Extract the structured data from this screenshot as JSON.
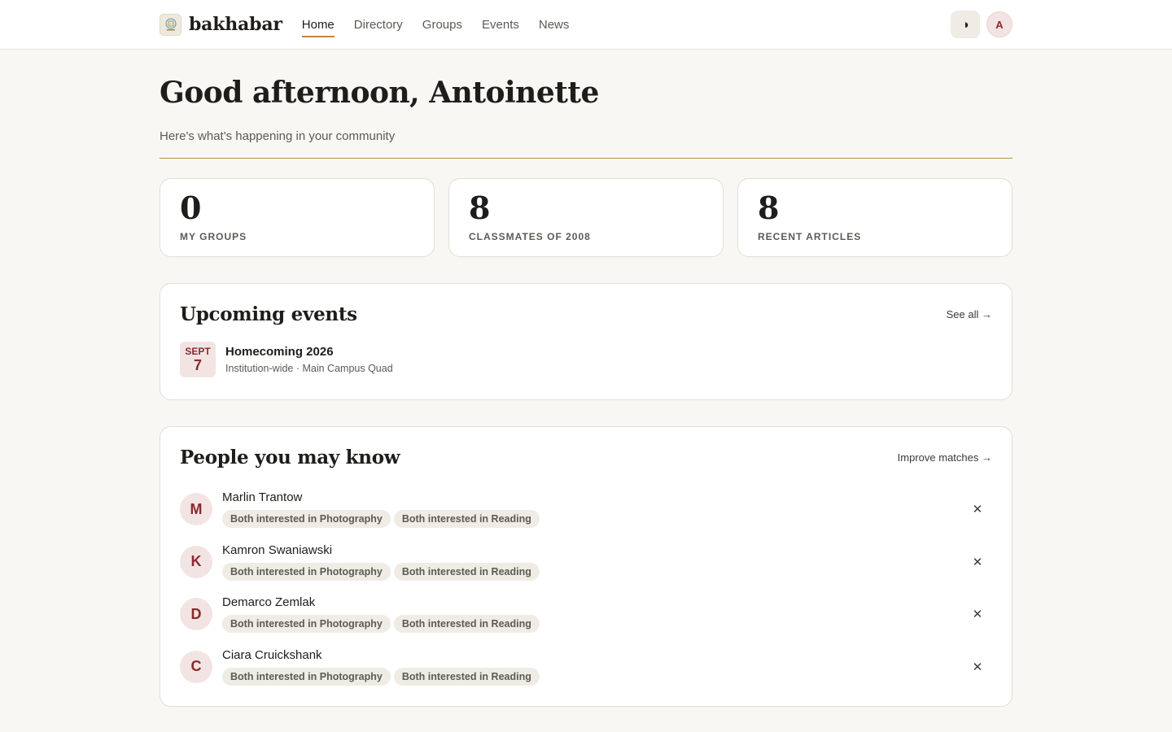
{
  "header": {
    "brand": "bakhabar",
    "nav": [
      {
        "label": "Home",
        "active": true
      },
      {
        "label": "Directory",
        "active": false
      },
      {
        "label": "Groups",
        "active": false
      },
      {
        "label": "Events",
        "active": false
      },
      {
        "label": "News",
        "active": false
      }
    ],
    "theme_toggle_icon": "◑",
    "user_initial": "A"
  },
  "main": {
    "greeting": "Good afternoon, Antoinette",
    "subtitle": "Here's what's happening in your community",
    "stats": [
      {
        "value": "0",
        "label": "My groups"
      },
      {
        "value": "8",
        "label": "Classmates of 2008"
      },
      {
        "value": "8",
        "label": "Recent articles"
      }
    ]
  },
  "events": {
    "title": "Upcoming events",
    "see_all": "See all →",
    "items": [
      {
        "month": "SEPT",
        "day": "7",
        "title": "Homecoming 2026",
        "meta": "Institution-wide · Main Campus Quad"
      }
    ]
  },
  "people": {
    "title": "People you may know",
    "improve": "Improve matches →",
    "dismiss_icon": "✕",
    "items": [
      {
        "initial": "M",
        "name": "Marlin Trantow",
        "tags": [
          "Both interested in Photography",
          "Both interested in Reading"
        ]
      },
      {
        "initial": "K",
        "name": "Kamron Swaniawski",
        "tags": [
          "Both interested in Photography",
          "Both interested in Reading"
        ]
      },
      {
        "initial": "D",
        "name": "Demarco Zemlak",
        "tags": [
          "Both interested in Photography",
          "Both interested in Reading"
        ]
      },
      {
        "initial": "C",
        "name": "Ciara Cruickshank",
        "tags": [
          "Both interested in Photography",
          "Both interested in Reading"
        ]
      }
    ]
  },
  "colors": {
    "accent": "#b8893d",
    "brand_maroon": "#8a2a2e",
    "background": "#f8f7f4"
  }
}
